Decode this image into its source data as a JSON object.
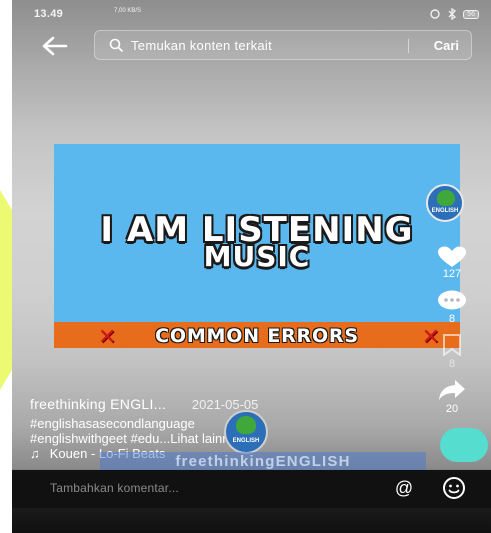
{
  "status_bar": {
    "time": "13.49",
    "network_speed": "7,00 KB/S",
    "battery": "56"
  },
  "search": {
    "placeholder": "Temukan konten terkait",
    "action_label": "Cari"
  },
  "video": {
    "title_line1": "I AM LISTENING",
    "title_line2": "MUSIC",
    "banner": "COMMON ERRORS"
  },
  "actions": {
    "like_count": "127",
    "comment_count": "8",
    "favorite_count": "8",
    "share_count": "20"
  },
  "caption": {
    "author": "freethinking ENGLI...",
    "date": "2021-05-05",
    "hashtags_line1": "#englishasasecondlanguage",
    "hashtags_line2": "#englishwithgeet #edu...",
    "see_more": "Lihat lainnya",
    "sound": "Kouen - Lo-Fi Beats"
  },
  "brand": {
    "logo_label": "ENGLISH",
    "channel_name": "freethinkingENGLISH"
  },
  "comment_bar": {
    "placeholder": "Tambahkan komentar..."
  },
  "colors": {
    "video_background": "#5ab8ef",
    "banner_orange": "#e76c1c",
    "music_disc": "#55ddd0",
    "watermark_yellow": "#e9f85a"
  },
  "icons": [
    "back-arrow-icon",
    "search-icon",
    "heart-icon",
    "comment-icon",
    "bookmark-icon",
    "share-icon",
    "music-note-icon",
    "mention-icon",
    "emoji-icon"
  ]
}
